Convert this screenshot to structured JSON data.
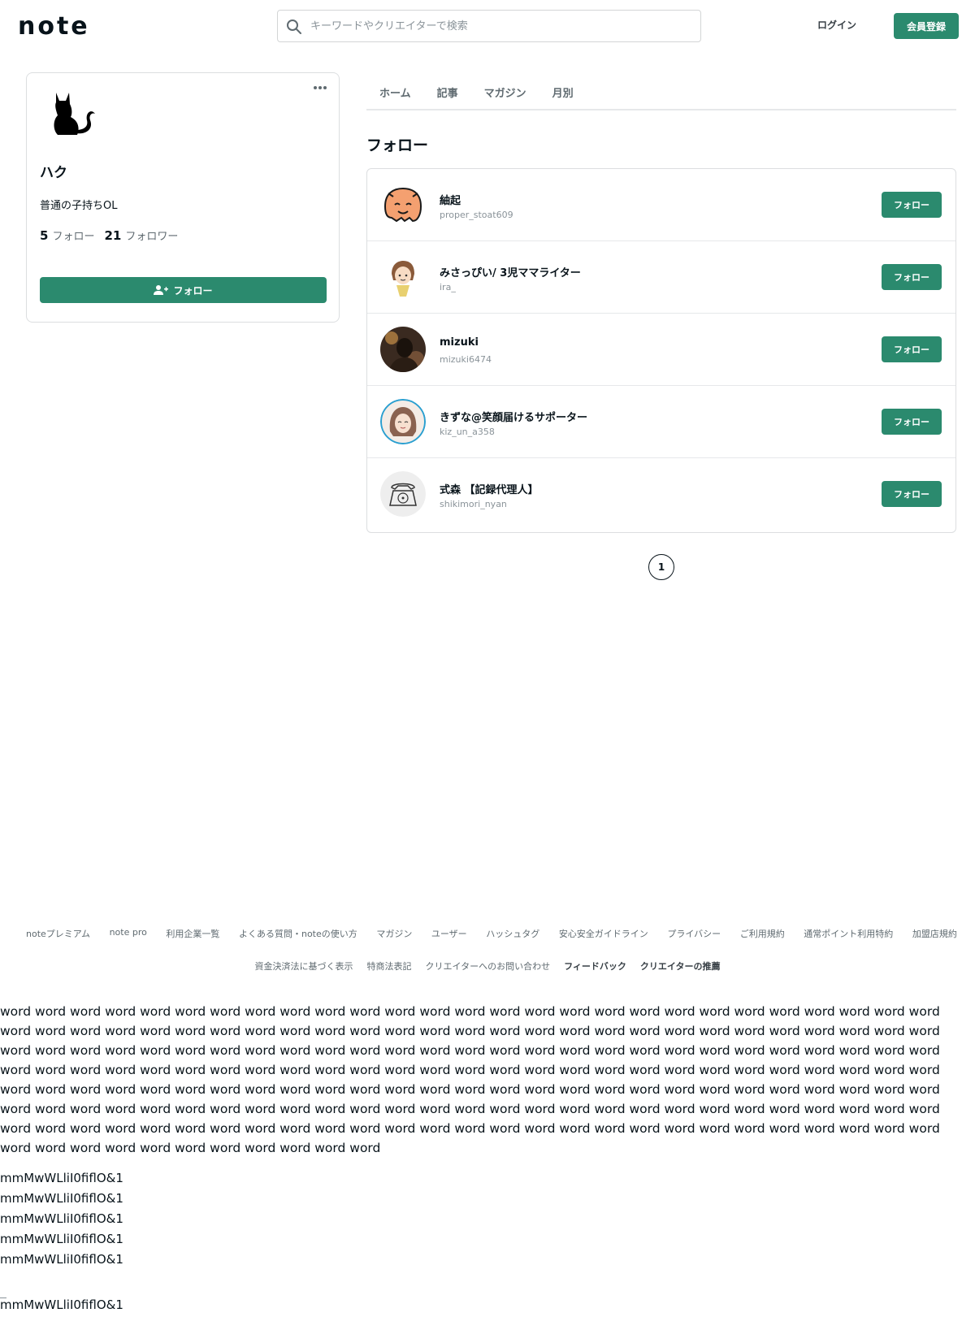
{
  "header": {
    "logo_text": "note",
    "search_placeholder": "キーワードやクリエイターで検索",
    "login_label": "ログイン",
    "signup_label": "会員登録"
  },
  "profile": {
    "name": "ハク",
    "bio": "普通の子持ちOL",
    "following_count": "5",
    "following_label": "フォロー",
    "follower_count": "21",
    "follower_label": "フォロワー",
    "follow_button_label": "フォロー",
    "avatar_icon": "cat-silhouette-icon"
  },
  "tabs": [
    "ホーム",
    "記事",
    "マガジン",
    "月別"
  ],
  "section_title": "フォロー",
  "follow_list": [
    {
      "name": "紬起",
      "id": "proper_stoat609",
      "button": "フォロー"
    },
    {
      "name": "みさっぴい/ 3児ママライター",
      "id": "ira_",
      "button": "フォロー"
    },
    {
      "name": "mizuki",
      "id": "mizuki6474",
      "button": "フォロー"
    },
    {
      "name": "きずな@笑顔届けるサポーター",
      "id": "kiz_un_a358",
      "button": "フォロー"
    },
    {
      "name": "式森 【記録代理人】",
      "id": "shikimori_nyan",
      "button": "フォロー"
    }
  ],
  "pagination": {
    "current": "1"
  },
  "footer": {
    "row1": [
      "noteプレミアム",
      "note pro",
      "利用企業一覧",
      "よくある質問・noteの使い方",
      "マガジン",
      "ユーザー",
      "ハッシュタグ",
      "安心安全ガイドライン",
      "プライバシー",
      "ご利用規約",
      "通常ポイント利用特約",
      "加盟店規約"
    ],
    "row2": [
      "資金決済法に基づく表示",
      "特商法表記",
      "クリエイターへのお問い合わせ",
      "フィードバック",
      "クリエイターの推薦"
    ]
  },
  "filler_text": "word word word word word word word word word word word word word word word word word word word word word word word word word word word word word word word word word word word word word word word word word word word word word word word word word word word word word word word word word word word word word word word word word word word word word word word word word word word word word word word word word word word word word word word word word word word word word word word word word word word word word word word word word word word word word word word word word word word word word word word word word word word word word word word word word word word word word word word word word word word word word word word word word word word word word word word word word word word word word word word word word word word word word word word word word word word word word word word word word word word word word word word word word word word word word word word word word word word word word word word word",
  "font_samples": [
    "mmMwWLliI0fiflO&1",
    "mmMwWLliI0fiflO&1",
    "mmMwWLliI0fiflO&1",
    "mmMwWLliI0fiflO&1",
    "mmMwWLliI0fiflO&1",
    "mmMwWLliI0fiflO&1"
  ],
  "colors": {
    "accent": "#2b8a6e",
    "text": "#08131a",
    "muted": "#5f6a70",
    "border": "#dcdee0"
  }
}
